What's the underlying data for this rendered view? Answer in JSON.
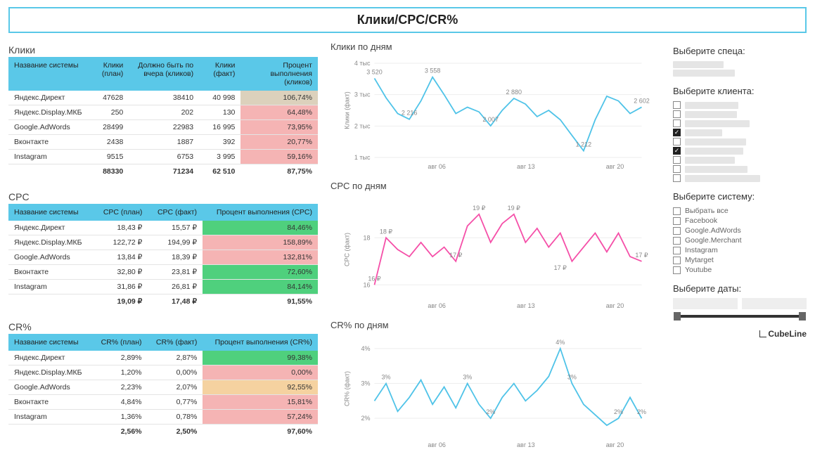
{
  "page_title": "Клики/CPC/CR%",
  "tables": {
    "clicks": {
      "title": "Клики",
      "headers": [
        "Название системы",
        "Клики (план)",
        "Должно быть по вчера (кликов)",
        "Клики (факт)",
        "Процент выполнения (кликов)"
      ],
      "rows": [
        {
          "name": "Яндекс.Директ",
          "plan": "47628",
          "bytoday": "38410",
          "fact": "40 998",
          "pct": "106,74%",
          "tone": "beige"
        },
        {
          "name": "Яндекс.Display.МКБ",
          "plan": "250",
          "bytoday": "202",
          "fact": "130",
          "pct": "64,48%",
          "tone": "pink"
        },
        {
          "name": "Google.AdWords",
          "plan": "28499",
          "bytoday": "22983",
          "fact": "16 995",
          "pct": "73,95%",
          "tone": "pink"
        },
        {
          "name": "Вконтакте",
          "plan": "2438",
          "bytoday": "1887",
          "fact": "392",
          "pct": "20,77%",
          "tone": "pink"
        },
        {
          "name": "Instagram",
          "plan": "9515",
          "bytoday": "6753",
          "fact": "3 995",
          "pct": "59,16%",
          "tone": "pink"
        }
      ],
      "total": {
        "plan": "88330",
        "bytoday": "71234",
        "fact": "62 510",
        "pct": "87,75%"
      }
    },
    "cpc": {
      "title": "CPC",
      "headers": [
        "Название системы",
        "CPC (план)",
        "CPC (факт)",
        "Процент выполнения (CPC)"
      ],
      "rows": [
        {
          "name": "Яндекс.Директ",
          "plan": "18,43 ₽",
          "fact": "15,57 ₽",
          "pct": "84,46%",
          "tone": "green"
        },
        {
          "name": "Яндекс.Display.МКБ",
          "plan": "122,72 ₽",
          "fact": "194,99 ₽",
          "pct": "158,89%",
          "tone": "pink"
        },
        {
          "name": "Google.AdWords",
          "plan": "13,84 ₽",
          "fact": "18,39 ₽",
          "pct": "132,81%",
          "tone": "pink"
        },
        {
          "name": "Вконтакте",
          "plan": "32,80 ₽",
          "fact": "23,81 ₽",
          "pct": "72,60%",
          "tone": "green"
        },
        {
          "name": "Instagram",
          "plan": "31,86 ₽",
          "fact": "26,81 ₽",
          "pct": "84,14%",
          "tone": "green"
        }
      ],
      "total": {
        "plan": "19,09 ₽",
        "fact": "17,48 ₽",
        "pct": "91,55%"
      }
    },
    "cr": {
      "title": "CR%",
      "headers": [
        "Название системы",
        "CR% (план)",
        "CR% (факт)",
        "Процент выполнения (CR%)"
      ],
      "rows": [
        {
          "name": "Яндекс.Директ",
          "plan": "2,89%",
          "fact": "2,87%",
          "pct": "99,38%",
          "tone": "green"
        },
        {
          "name": "Яндекс.Display.МКБ",
          "plan": "1,20%",
          "fact": "0,00%",
          "pct": "0,00%",
          "tone": "pink"
        },
        {
          "name": "Google.AdWords",
          "plan": "2,23%",
          "fact": "2,07%",
          "pct": "92,55%",
          "tone": "orange"
        },
        {
          "name": "Вконтакте",
          "plan": "4,84%",
          "fact": "0,77%",
          "pct": "15,81%",
          "tone": "pink"
        },
        {
          "name": "Instagram",
          "plan": "1,36%",
          "fact": "0,78%",
          "pct": "57,24%",
          "tone": "pink"
        }
      ],
      "total": {
        "plan": "2,56%",
        "fact": "2,50%",
        "pct": "97,60%"
      }
    }
  },
  "chart_data": [
    {
      "id": "clicks_by_day",
      "type": "line",
      "title": "Клики по дням",
      "ylabel": "Клики (факт)",
      "x_ticks": [
        "авг 06",
        "авг 13",
        "авг 20"
      ],
      "y_ticks": [
        "1 тыс",
        "2 тыс",
        "3 тыс",
        "4 тыс"
      ],
      "ylim": [
        1000,
        4000
      ],
      "color": "#4fc3e8",
      "x": [
        0,
        1,
        2,
        3,
        4,
        5,
        6,
        7,
        8,
        9,
        10,
        11,
        12,
        13,
        14,
        15,
        16,
        17,
        18,
        19,
        20,
        21,
        22,
        23
      ],
      "values": [
        3520,
        2900,
        2400,
        2216,
        2800,
        3558,
        3000,
        2400,
        2600,
        2450,
        2007,
        2500,
        2880,
        2700,
        2300,
        2500,
        2200,
        1700,
        1212,
        2200,
        2950,
        2800,
        2400,
        2602
      ],
      "annotations": [
        {
          "x": 0,
          "y": 3520,
          "text": "3 520"
        },
        {
          "x": 3,
          "y": 2216,
          "text": "2 216"
        },
        {
          "x": 5,
          "y": 3558,
          "text": "3 558"
        },
        {
          "x": 10,
          "y": 2007,
          "text": "2 007"
        },
        {
          "x": 12,
          "y": 2880,
          "text": "2 880"
        },
        {
          "x": 18,
          "y": 1212,
          "text": "1 212"
        },
        {
          "x": 23,
          "y": 2602,
          "text": "2 602"
        }
      ]
    },
    {
      "id": "cpc_by_day",
      "type": "line",
      "title": "CPC по дням",
      "ylabel": "CPC (факт)",
      "x_ticks": [
        "авг 06",
        "авг 13",
        "авг 20"
      ],
      "y_ticks": [
        "16",
        "18"
      ],
      "ylim": [
        15.5,
        19.5
      ],
      "color": "#f54fa8",
      "x": [
        0,
        1,
        2,
        3,
        4,
        5,
        6,
        7,
        8,
        9,
        10,
        11,
        12,
        13,
        14,
        15,
        16,
        17,
        18,
        19,
        20,
        21,
        22,
        23
      ],
      "values": [
        16,
        18,
        17.5,
        17.2,
        17.8,
        17.2,
        17.6,
        17,
        18.5,
        19,
        17.8,
        18.6,
        19,
        17.8,
        18.4,
        17.6,
        18.2,
        17,
        17.6,
        18.2,
        17.4,
        18.2,
        17.2,
        17
      ],
      "annotations": [
        {
          "x": 0,
          "y": 16,
          "text": "16 ₽"
        },
        {
          "x": 1,
          "y": 18,
          "text": "18 ₽"
        },
        {
          "x": 7,
          "y": 17,
          "text": "17 ₽"
        },
        {
          "x": 9,
          "y": 19,
          "text": "19 ₽"
        },
        {
          "x": 12,
          "y": 19,
          "text": "19 ₽"
        },
        {
          "x": 16,
          "y": 17,
          "text": "17 ₽",
          "below": true
        },
        {
          "x": 23,
          "y": 17,
          "text": "17 ₽"
        }
      ]
    },
    {
      "id": "cr_by_day",
      "type": "line",
      "title": "CR% по дням",
      "ylabel": "CR% (факт)",
      "x_ticks": [
        "авг 06",
        "авг 13",
        "авг 20"
      ],
      "y_ticks": [
        "2%",
        "3%",
        "4%"
      ],
      "ylim": [
        1.5,
        4.2
      ],
      "color": "#4fc3e8",
      "x": [
        0,
        1,
        2,
        3,
        4,
        5,
        6,
        7,
        8,
        9,
        10,
        11,
        12,
        13,
        14,
        15,
        16,
        17,
        18,
        19,
        20,
        21,
        22,
        23
      ],
      "values": [
        2.5,
        3,
        2.2,
        2.6,
        3.1,
        2.4,
        2.9,
        2.3,
        3,
        2.4,
        2.0,
        2.6,
        3,
        2.5,
        2.8,
        3.2,
        4,
        3,
        2.4,
        2.1,
        1.8,
        2.0,
        2.6,
        2.0
      ],
      "annotations": [
        {
          "x": 1,
          "y": 3,
          "text": "3%"
        },
        {
          "x": 8,
          "y": 3,
          "text": "3%"
        },
        {
          "x": 10,
          "y": 2,
          "text": "2%"
        },
        {
          "x": 16,
          "y": 4,
          "text": "4%"
        },
        {
          "x": 17,
          "y": 3,
          "text": "3%"
        },
        {
          "x": 21,
          "y": 2,
          "text": "2%"
        },
        {
          "x": 23,
          "y": 2,
          "text": "2%"
        }
      ]
    }
  ],
  "filters": {
    "spec": {
      "title": "Выберите спеца:",
      "items_redacted": 2
    },
    "client": {
      "title": "Выберите клиента:",
      "items": [
        {
          "checked": false
        },
        {
          "checked": false
        },
        {
          "checked": false
        },
        {
          "checked": true
        },
        {
          "checked": false
        },
        {
          "checked": true
        },
        {
          "checked": false
        },
        {
          "checked": false
        },
        {
          "checked": false
        }
      ]
    },
    "system": {
      "title": "Выберите систему:",
      "items": [
        {
          "label": "Выбрать все",
          "checked": false
        },
        {
          "label": "Facebook",
          "checked": false
        },
        {
          "label": "Google.AdWords",
          "checked": false
        },
        {
          "label": "Google.Merchant",
          "checked": false
        },
        {
          "label": "Instagram",
          "checked": false
        },
        {
          "label": "Mytarget",
          "checked": false
        },
        {
          "label": "Youtube",
          "checked": false
        }
      ]
    },
    "dates": {
      "title": "Выберите даты:"
    }
  },
  "logo_text": "CubeLine"
}
